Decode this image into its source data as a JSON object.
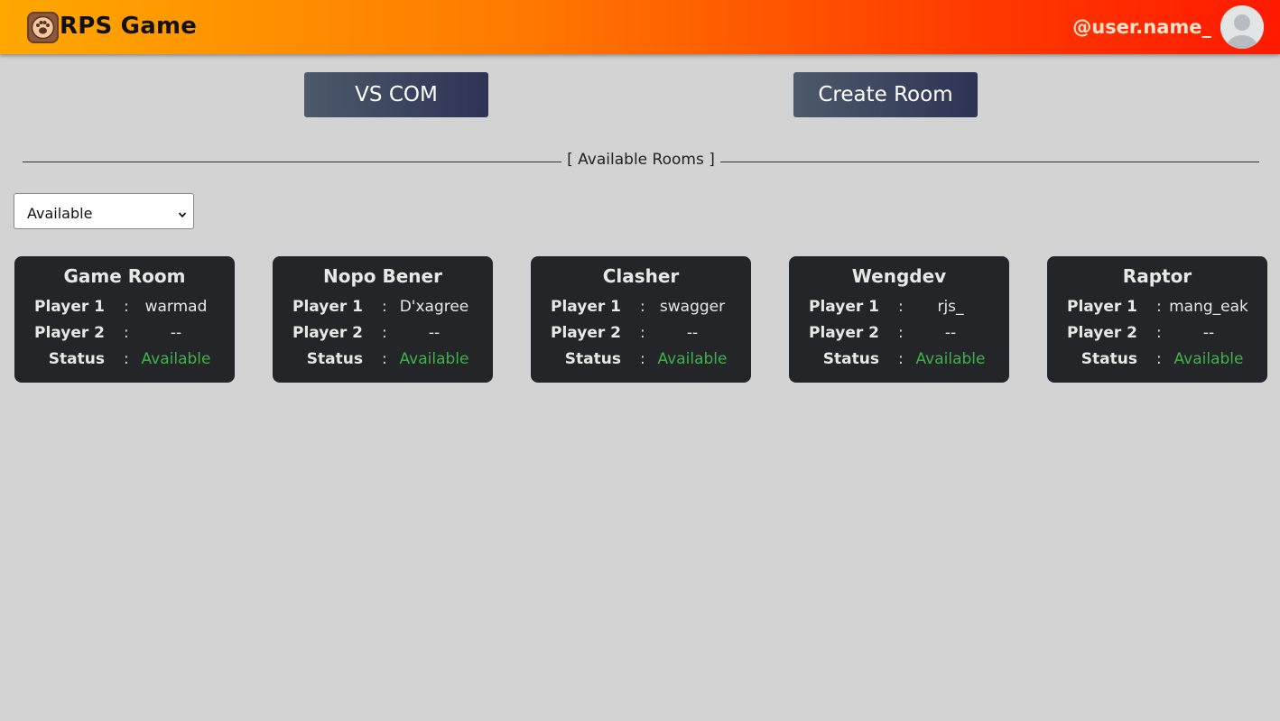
{
  "header": {
    "brand": "RPS Game",
    "username": "@user.name_"
  },
  "actions": {
    "vs_com": "VS COM",
    "create_room": "Create Room"
  },
  "rooms_section": {
    "title": "[ Available Rooms ]",
    "filter_value": "Available"
  },
  "labels": {
    "player1": "Player 1",
    "player2": "Player 2",
    "status": "Status",
    "sep": ":"
  },
  "rooms": [
    {
      "name": "Game Room",
      "player1": "warmad",
      "player2": "--",
      "status": "Available"
    },
    {
      "name": "Nopo Bener",
      "player1": "D'xagree",
      "player2": "--",
      "status": "Available"
    },
    {
      "name": "Clasher",
      "player1": "swagger",
      "player2": "--",
      "status": "Available"
    },
    {
      "name": "Wengdev",
      "player1": "rjs_",
      "player2": "--",
      "status": "Available"
    },
    {
      "name": "Raptor",
      "player1": "mang_eak",
      "player2": "--",
      "status": "Available"
    }
  ],
  "colors": {
    "status_available": "#3fb24a",
    "card_bg": "#232528",
    "page_bg": "#d3d3d3"
  },
  "icons": {
    "logo": "paw-logo-icon",
    "avatar": "user-avatar-icon",
    "select": "chevron-down-icon"
  }
}
